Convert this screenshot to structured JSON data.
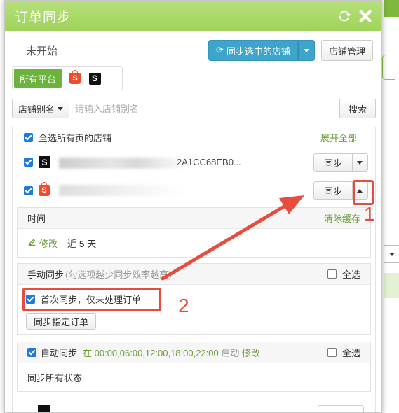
{
  "dialog": {
    "title": "订单同步",
    "status": "未开始",
    "sync_selected_label": "同步选中的店铺",
    "store_manage_label": "店铺管理"
  },
  "platforms": {
    "all_label": "所有平台",
    "shopee_letter": "S",
    "shein_letter": "S"
  },
  "search": {
    "alias_label": "店铺别名",
    "placeholder": "请输入店铺别名",
    "search_label": "搜索"
  },
  "list": {
    "select_all_label": "全选所有页的店铺",
    "expand_all_label": "展开全部",
    "stores": [
      {
        "name_visible": "2A1CC68EB0...",
        "sync_label": "同步"
      },
      {
        "name_visible": "",
        "sync_label": "同步"
      }
    ]
  },
  "time_panel": {
    "title": "时间",
    "clear_cache": "清除缓存",
    "edit_label": "修改",
    "near_prefix": "近",
    "days_value": "5",
    "days_unit": "天"
  },
  "manual_panel": {
    "title": "手动同步",
    "hint": "(勾选项越少同步效率越高)",
    "select_all": "全选",
    "first_sync_label": "首次同步，仅未处理订单",
    "sync_specified_label": "同步指定订单"
  },
  "auto_panel": {
    "title": "自动同步",
    "schedule": "在 00:00,06:00,12:00,18:00,22:00",
    "enabled": "启动",
    "edit_label": "修改",
    "select_all": "全选",
    "body": "同步所有状态"
  },
  "annotations": {
    "n1": "1",
    "n2": "2",
    "color": "#e74c3c"
  },
  "colors": {
    "header_green": "#9fd35a",
    "primary_blue": "#3fa4c9",
    "tab_green": "#6cb33e",
    "link_green": "#6a9b3a",
    "checkbox_blue": "#1f7ae0"
  }
}
